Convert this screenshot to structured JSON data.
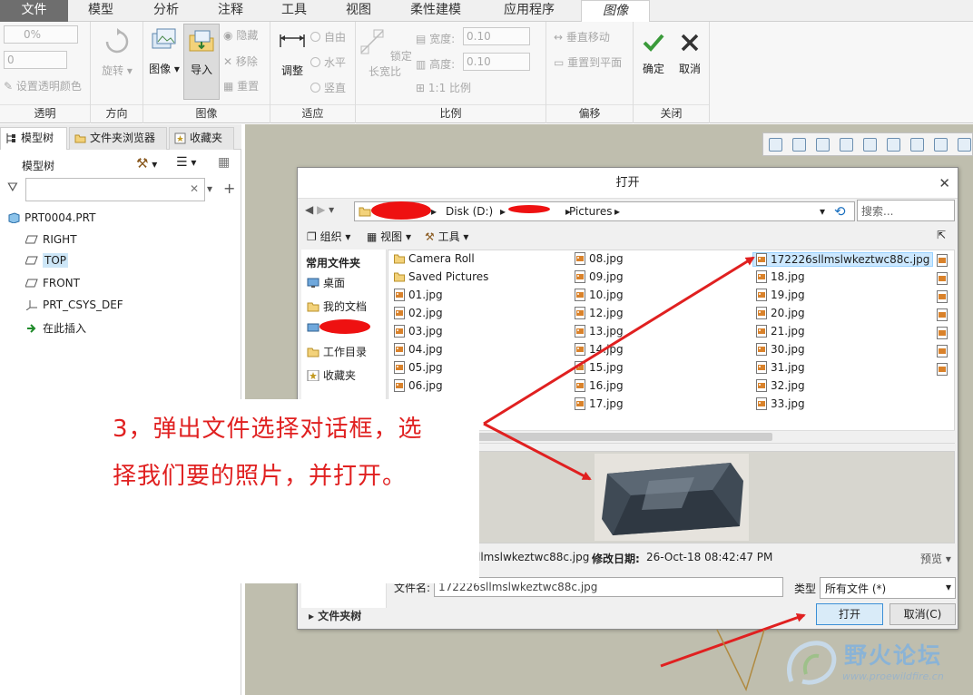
{
  "ribbon_tabs": [
    "文件",
    "模型",
    "分析",
    "注释",
    "工具",
    "视图",
    "柔性建模",
    "应用程序",
    "图像"
  ],
  "ribbon": {
    "transparency": {
      "value": "0%",
      "value2": "0",
      "set_color": "设置透明颜色",
      "label": "透明"
    },
    "orientation": {
      "rotate": "旋转",
      "label": "方向"
    },
    "image": {
      "image_btn": "图像",
      "import_btn": "导入",
      "hide": "隐藏",
      "remove": "移除",
      "reset": "重置",
      "label": "图像"
    },
    "fit": {
      "adjust": "调整",
      "free": "自由",
      "horizontal": "水平",
      "vertical": "竖直",
      "label": "适应"
    },
    "scale": {
      "lock_ratio": "锁定长宽比",
      "width_label": "宽度:",
      "width_value": "0.10",
      "height_label": "高度:",
      "height_value": "0.10",
      "one_to_one": "1:1 比例",
      "label": "比例"
    },
    "offset": {
      "move_vertical": "垂直移动",
      "reset_plane": "重置到平面",
      "label": "偏移"
    },
    "close": {
      "ok": "确定",
      "cancel": "取消",
      "label": "关闭"
    }
  },
  "left_panel": {
    "tabs": [
      "模型树",
      "文件夹浏览器",
      "收藏夹"
    ],
    "tree_title": "模型树",
    "tree_nodes": [
      "PRT0004.PRT",
      "RIGHT",
      "TOP",
      "FRONT",
      "PRT_CSYS_DEF",
      "在此插入"
    ]
  },
  "dialog": {
    "title": "打开",
    "address": {
      "drive": "Disk (D:)",
      "folder": "Pictures"
    },
    "search_placeholder": "搜索...",
    "toolbar": {
      "organize": "组织",
      "views": "视图",
      "tools": "工具"
    },
    "nav": {
      "header": "常用文件夹",
      "items": [
        "桌面",
        "我的文档",
        "工作目录",
        "收藏夹"
      ]
    },
    "files": {
      "col1": [
        "Camera Roll",
        "Saved Pictures",
        "01.jpg",
        "02.jpg",
        "03.jpg",
        "04.jpg",
        "05.jpg",
        "06.jpg"
      ],
      "col2": [
        "08.jpg",
        "09.jpg",
        "10.jpg",
        "12.jpg",
        "13.jpg",
        "14.jpg",
        "15.jpg",
        "16.jpg",
        "17.jpg"
      ],
      "col3": [
        "172226sllmslwkeztwc88c.jpg",
        "18.jpg",
        "19.jpg",
        "20.jpg",
        "21.jpg",
        "30.jpg",
        "31.jpg",
        "32.jpg",
        "33.jpg"
      ]
    },
    "details": {
      "name_partial": "llmslwkeztwc88c.jpg",
      "modified_label": "修改日期:",
      "modified_value": "26-Oct-18 08:42:47 PM",
      "preview": "预览"
    },
    "filename_label": "文件名:",
    "filename_value": "172226sllmslwkeztwc88c.jpg",
    "type_label": "类型",
    "type_value": "所有文件 (*)",
    "folder_tree": "文件夹树",
    "open_btn": "打开",
    "cancel_btn": "取消(C)"
  },
  "annotation": {
    "line1": "3，弹出文件选择对话框，选",
    "line2": "择我们要的照片，并打开。"
  },
  "watermark": {
    "main": "野火论坛",
    "url": "www.proewildfire.cn"
  },
  "colors": {
    "annotation_red": "#e02020",
    "graphics_bg": "#bfbeae",
    "selection_blue": "#cde6f7"
  }
}
